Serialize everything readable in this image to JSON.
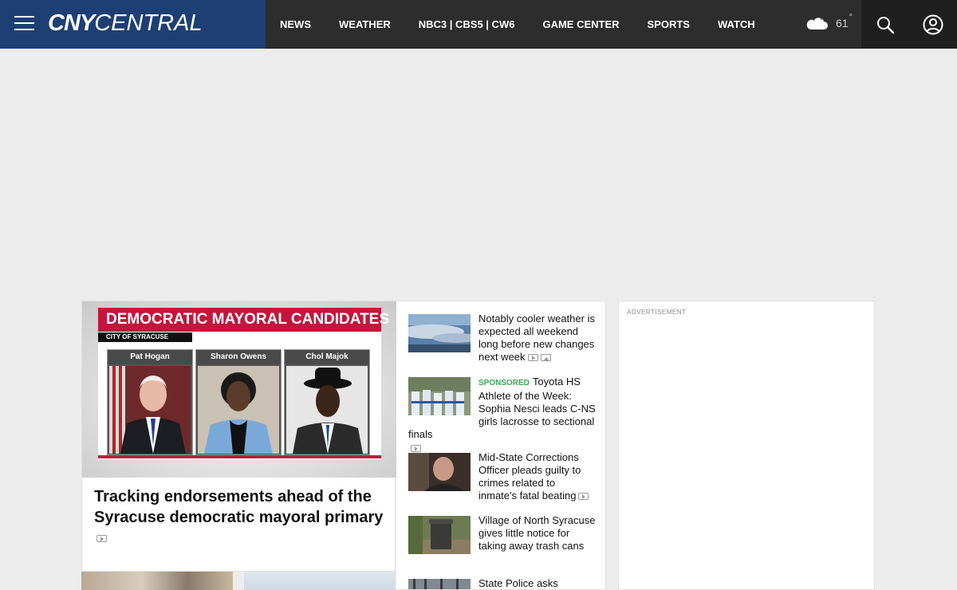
{
  "header": {
    "logo_bold": "CNY",
    "logo_light": "CENTRAL",
    "nav": [
      "NEWS",
      "WEATHER",
      "NBC3 | CBS5 | CW6",
      "GAME CENTER",
      "SPORTS",
      "WATCH"
    ],
    "weather": {
      "icon": "cloud-icon",
      "temperature": "61",
      "unit": "°"
    }
  },
  "lead_story": {
    "graphic": {
      "banner": "DEMOCRATIC MAYORAL CANDIDATES",
      "subtitle": "CITY OF SYRACUSE",
      "candidates": [
        "Pat Hogan",
        "Sharon Owens",
        "Chol Majok"
      ]
    },
    "headline": "Tracking endorsements ahead of the Syracuse democratic mayoral primary"
  },
  "stories": [
    {
      "headline": "Notably cooler weather is expected all weekend long before new changes next week"
    },
    {
      "sponsored": "SPONSORED",
      "headline": "Toyota HS Athlete of the Week: Sophia Nesci leads C-NS girls lacrosse to sectional finals"
    },
    {
      "headline": "Mid-State Corrections Officer pleads guilty to crimes related to inmate's fatal beating"
    },
    {
      "headline": "Village of North Syracuse gives little notice for taking away trash cans"
    },
    {
      "headline": "State Police asks"
    }
  ],
  "ad": {
    "label": "ADVERTISEMENT"
  },
  "colors": {
    "brand_blue": "#1e3f73",
    "header_bg": "#2d2d2d",
    "accent_red": "#c4163c",
    "sponsored_green": "#3aa655"
  }
}
